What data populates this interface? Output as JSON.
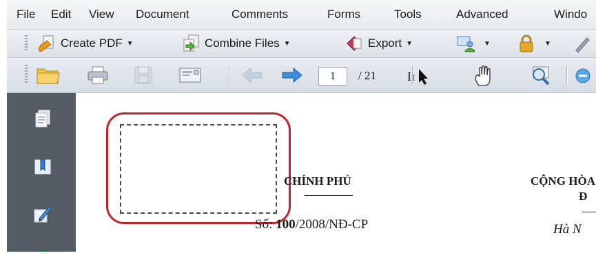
{
  "menu": [
    "File",
    "Edit",
    "View",
    "Document",
    "Comments",
    "Forms",
    "Tools",
    "Advanced",
    "Windo"
  ],
  "toolbar": {
    "create_pdf": "Create PDF",
    "combine_files": "Combine Files",
    "export": "Export"
  },
  "navigation": {
    "current_page": "1",
    "total_pages": "/ 21"
  },
  "document": {
    "gov_title": "CHÍNH PHỦ",
    "decree_prefix": "Số: ",
    "decree_number": "100",
    "decree_suffix": "/2008/NĐ-CP",
    "republic_line1": "CỘNG HÒA",
    "republic_line2": "Đ",
    "place": "Hà N"
  },
  "colors": {
    "highlight_ring": "#c0242b",
    "nav_panel": "#555b63",
    "help_icon": "#2e9b3a"
  }
}
